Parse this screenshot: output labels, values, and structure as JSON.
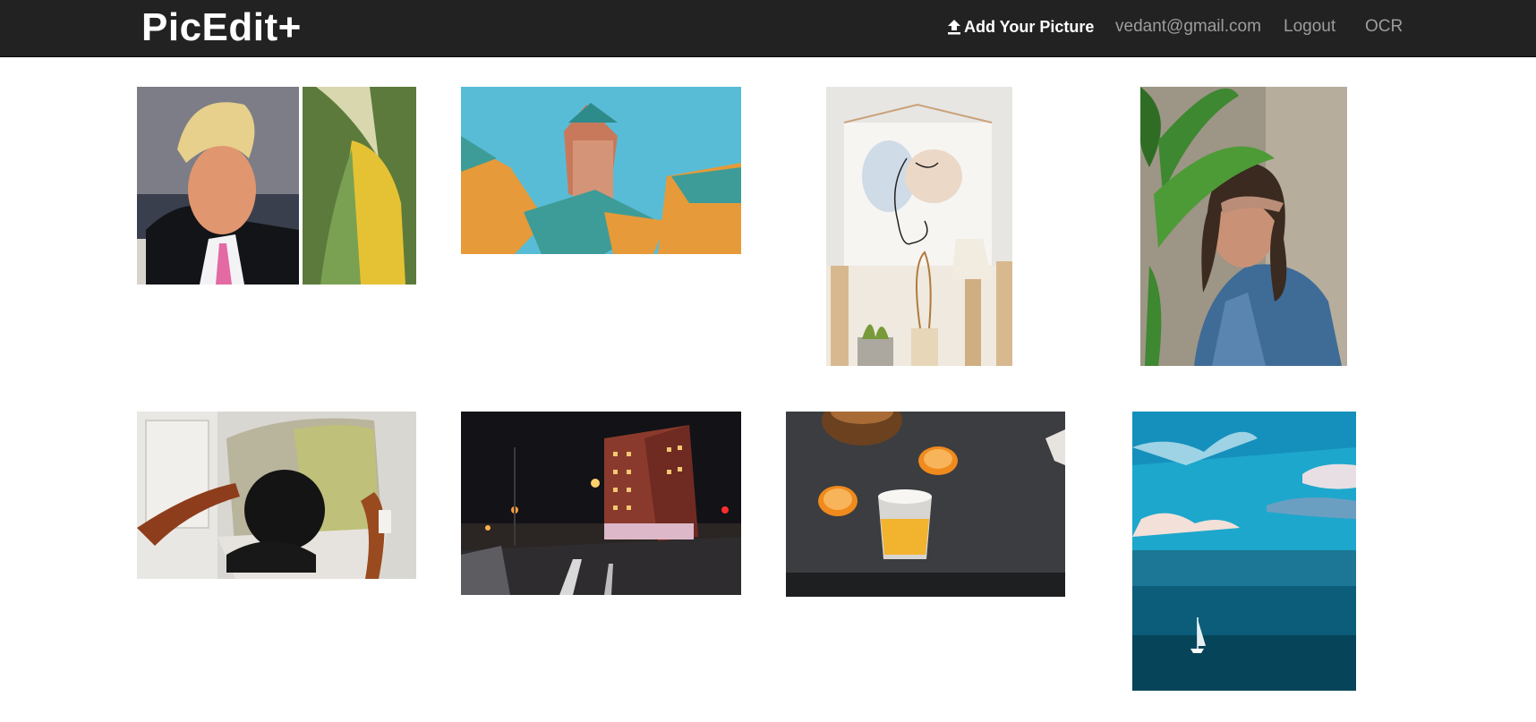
{
  "navbar": {
    "brand": "PicEdit+",
    "add_picture": "Add Your Picture",
    "add_picture_icon": "upload-icon",
    "user_email": "vedant@gmail.com",
    "logout": "Logout",
    "ocr": "OCR"
  },
  "colors": {
    "navbar_bg": "#222222",
    "nav_text": "#9d9d9d",
    "brand_text": "#ffffff"
  },
  "gallery": {
    "photos": [
      {
        "subject": "man-and-corn-collage"
      },
      {
        "subject": "cube-houses-building"
      },
      {
        "subject": "line-art-poster"
      },
      {
        "subject": "woman-behind-palm-leaf"
      },
      {
        "subject": "pug-on-armchair"
      },
      {
        "subject": "night-street-hotel"
      },
      {
        "subject": "orange-juice-on-table"
      },
      {
        "subject": "sailboat-on-ocean"
      }
    ]
  }
}
